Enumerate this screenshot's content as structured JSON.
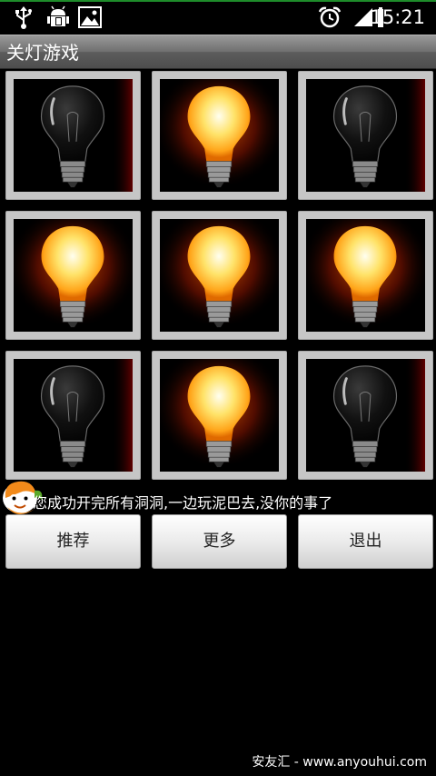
{
  "status_bar": {
    "time": "15:21",
    "icons": [
      "usb-icon",
      "android-debug-icon",
      "image-icon",
      "alarm-icon",
      "signal-icon",
      "battery-icon"
    ],
    "accent_color": "#1e8c2a"
  },
  "app": {
    "title": "关灯游戏"
  },
  "grid": {
    "rows": 3,
    "cols": 3,
    "bulbs": [
      {
        "state": "off"
      },
      {
        "state": "on"
      },
      {
        "state": "off"
      },
      {
        "state": "on"
      },
      {
        "state": "on"
      },
      {
        "state": "on"
      },
      {
        "state": "off"
      },
      {
        "state": "on"
      },
      {
        "state": "off"
      }
    ]
  },
  "message": "您成功开完所有洞洞,一边玩泥巴去,没你的事了",
  "buttons": {
    "recommend": "推荐",
    "more": "更多",
    "exit": "退出"
  },
  "footer": "安友汇 - www.anyouhui.com"
}
